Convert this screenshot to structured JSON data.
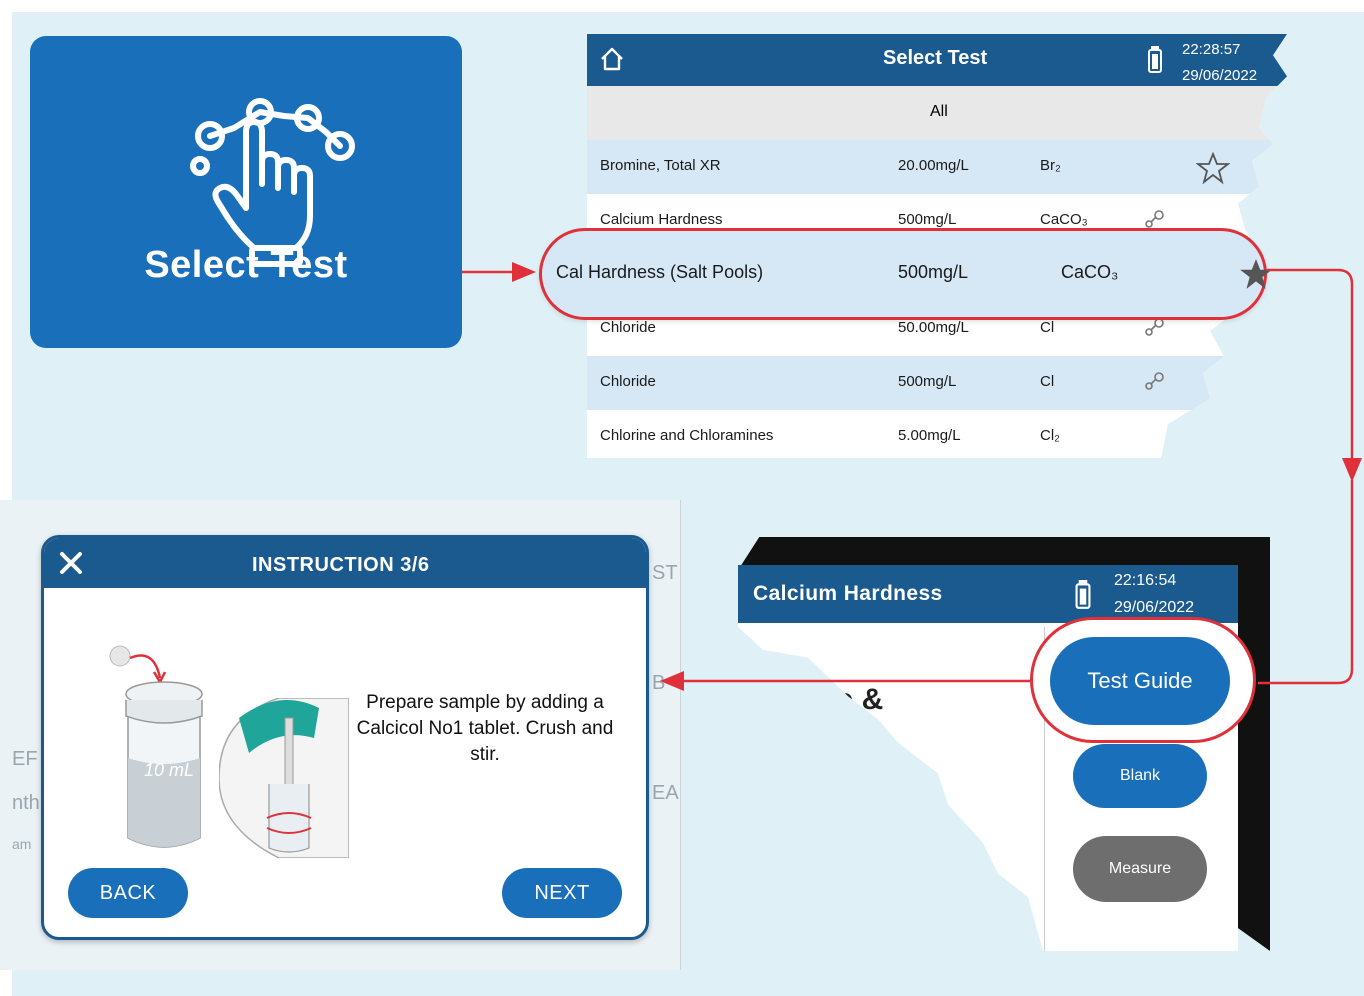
{
  "tile": {
    "label": "Select Test",
    "icon": "hand-tap-icon"
  },
  "select_test_screen": {
    "title": "Select Test",
    "time": "22:28:57",
    "date": "29/06/2022",
    "filter": "All",
    "rows": [
      {
        "name": "Bromine, Total XR",
        "range": "20.00mg/L",
        "unit": "Br₂"
      },
      {
        "name": "Calcium Hardness",
        "range": "500mg/L",
        "unit": "CaCO₃"
      },
      {
        "name": "Chloride",
        "range": "50.00mg/L",
        "unit": "Cl"
      },
      {
        "name": "Chloride",
        "range": "500mg/L",
        "unit": "Cl"
      },
      {
        "name": "Chlorine and Chloramines",
        "range": "5.00mg/L",
        "unit": "Cl₂"
      }
    ],
    "highlight": {
      "name": "Cal Hardness (Salt Pools)",
      "range": "500mg/L",
      "unit": "CaCO₃"
    }
  },
  "calcium_screen": {
    "title": "Calcium Hardness",
    "time": "22:16:54",
    "date": "29/06/2022",
    "fragment": "ple &",
    "test_guide": "Test Guide",
    "blank": "Blank",
    "measure": "Measure"
  },
  "instruction": {
    "title": "INSTRUCTION 3/6",
    "text": "Prepare sample by adding a Calcicol No1 tablet. Crush and stir.",
    "vial_label": "10 mL",
    "back": "BACK",
    "next": "NEXT"
  },
  "background_fragments": [
    "ST",
    "B",
    "EA",
    "EF",
    "nth",
    "am"
  ],
  "colors": {
    "brand_blue": "#1a6fba",
    "header_navy": "#1b5a8e",
    "highlight_red": "#e0303a",
    "row_blue": "#d6e8f6"
  }
}
